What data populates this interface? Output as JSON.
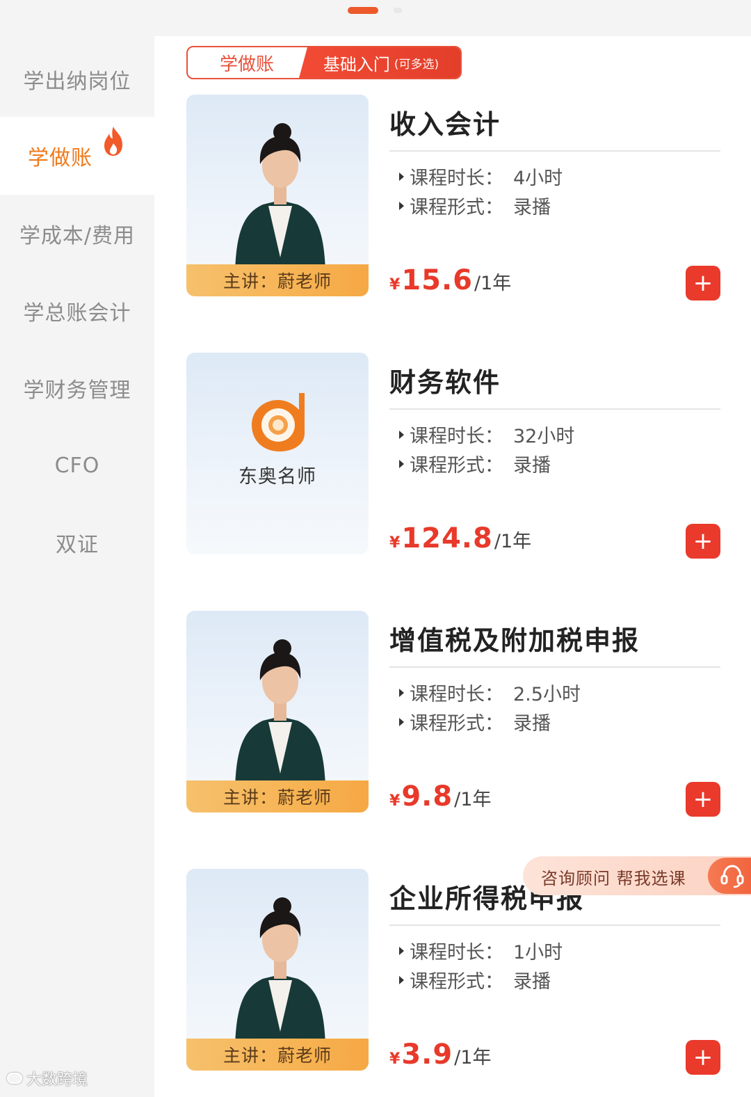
{
  "sidebar": {
    "items": [
      {
        "label": "学出纳岗位"
      },
      {
        "label": "学做账"
      },
      {
        "label": "学成本/费用"
      },
      {
        "label": "学总账会计"
      },
      {
        "label": "学财务管理"
      },
      {
        "label": "CFO"
      },
      {
        "label": "双证"
      }
    ],
    "active_index": 1
  },
  "tabs": {
    "left": "学做账",
    "right": "基础入门",
    "right_sub": "(可多选)"
  },
  "courses": [
    {
      "title": "收入会计",
      "duration_label": "课程时长：",
      "duration": "4小时",
      "format_label": "课程形式：",
      "format": "录播",
      "currency": "¥",
      "price": "15.6",
      "unit": "/1年",
      "teacher": "主讲：蔚老师",
      "add": "+"
    },
    {
      "title": "财务软件",
      "duration_label": "课程时长：",
      "duration": "32小时",
      "format_label": "课程形式：",
      "format": "录播",
      "currency": "¥",
      "price": "124.8",
      "unit": "/1年",
      "logo_text": "东奥名师",
      "add": "+"
    },
    {
      "title": "增值税及附加税申报",
      "duration_label": "课程时长：",
      "duration": "2.5小时",
      "format_label": "课程形式：",
      "format": "录播",
      "currency": "¥",
      "price": "9.8",
      "unit": "/1年",
      "teacher": "主讲：蔚老师",
      "add": "+"
    },
    {
      "title": "企业所得税申报",
      "duration_label": "课程时长：",
      "duration": "1小时",
      "format_label": "课程形式：",
      "format": "录播",
      "currency": "¥",
      "price": "3.9",
      "unit": "/1年",
      "teacher": "主讲：蔚老师",
      "add": "+"
    }
  ],
  "consult": {
    "label": "咨询顾问 帮我选课"
  },
  "watermark": "大数跨境",
  "icons": {
    "hot": "flame-icon",
    "consult": "headset-icon",
    "add": "plus-icon",
    "brand": "dongao-logo-icon"
  },
  "colors": {
    "accent": "#e93a2c",
    "active_text": "#ef7a1c",
    "teacher_bar": "#f7b556"
  }
}
